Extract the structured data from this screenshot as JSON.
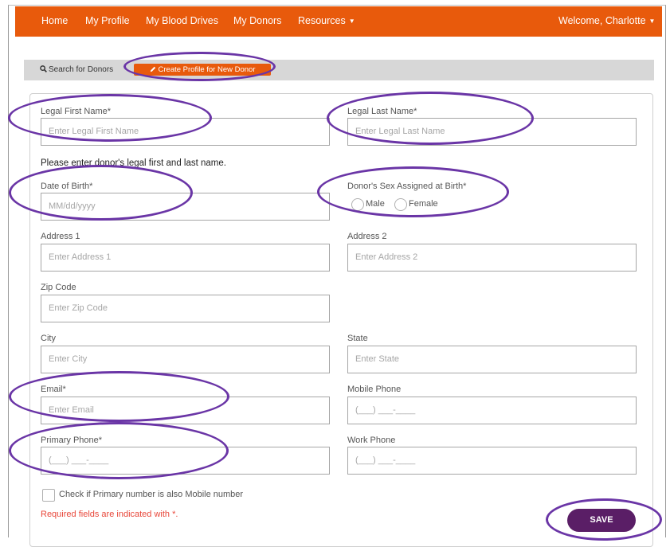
{
  "nav": {
    "home": "Home",
    "my_profile": "My Profile",
    "my_blood_drives": "My Blood Drives",
    "my_donors": "My Donors",
    "resources": "Resources",
    "welcome": "Welcome, Charlotte",
    "brand_color": "#e85a0c"
  },
  "toolbar": {
    "search_donors": "Search for Donors",
    "create_profile": "Create Profile for New Donor"
  },
  "form": {
    "first_name": {
      "label": "Legal First Name*",
      "placeholder": "Enter Legal First Name"
    },
    "last_name": {
      "label": "Legal Last Name*",
      "placeholder": "Enter Legal Last Name"
    },
    "name_note": "Please enter donor's legal first and last name.",
    "dob": {
      "label": "Date of Birth*",
      "placeholder": "MM/dd/yyyy"
    },
    "sex": {
      "label": "Donor's Sex Assigned at Birth*",
      "options": [
        "Male",
        "Female"
      ]
    },
    "address1": {
      "label": "Address 1",
      "placeholder": "Enter Address 1"
    },
    "address2": {
      "label": "Address 2",
      "placeholder": "Enter Address 2"
    },
    "zip": {
      "label": "Zip Code",
      "placeholder": "Enter Zip Code"
    },
    "city": {
      "label": "City",
      "placeholder": "Enter City"
    },
    "state": {
      "label": "State",
      "placeholder": "Enter State"
    },
    "email": {
      "label": "Email*",
      "placeholder": "Enter Email"
    },
    "mobile_phone": {
      "label": "Mobile Phone",
      "placeholder": "(___) ___-____"
    },
    "primary_phone": {
      "label": "Primary Phone*",
      "placeholder": "(___) ___-____"
    },
    "work_phone": {
      "label": "Work Phone",
      "placeholder": "(___) ___-____"
    },
    "mobile_check_label": "Check if Primary number is also Mobile number",
    "required_note": "Required fields are indicated with *.",
    "save": "SAVE"
  },
  "annotation_color": "#6a35a6",
  "save_color": "#5a1e66"
}
